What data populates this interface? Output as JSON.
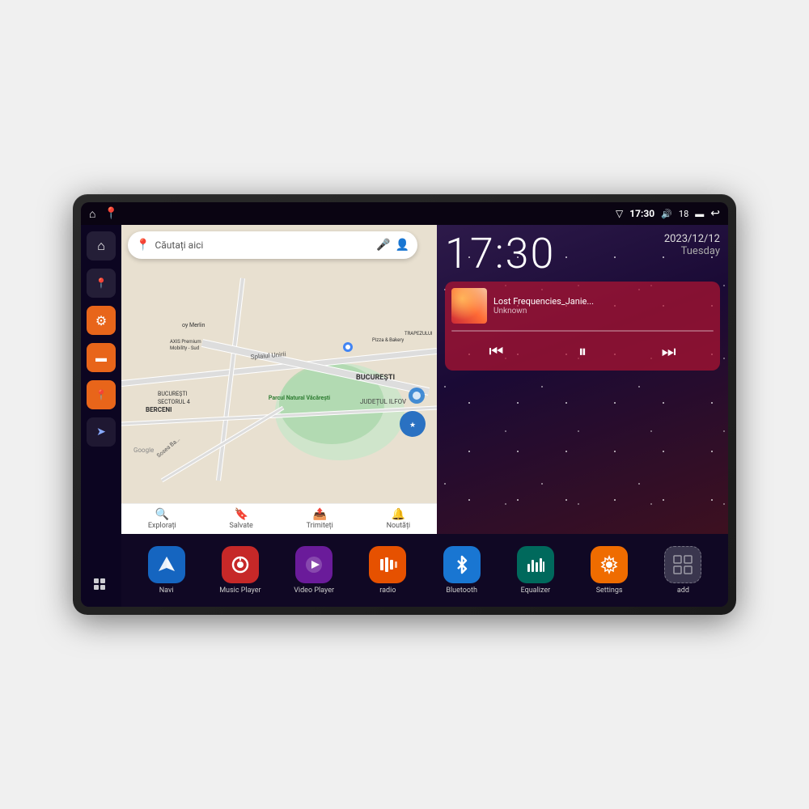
{
  "device": {
    "status_bar": {
      "signal_icon": "▼",
      "wifi_icon": "▾",
      "time": "17:30",
      "volume_icon": "🔊",
      "battery_level": "18",
      "battery_icon": "🔋",
      "back_icon": "↩"
    },
    "sidebar": {
      "items": [
        {
          "name": "home-button",
          "icon": "⌂",
          "style": "dark"
        },
        {
          "name": "maps-button",
          "icon": "📍",
          "style": "dark"
        },
        {
          "name": "settings-button",
          "icon": "⚙",
          "style": "orange"
        },
        {
          "name": "files-button",
          "icon": "📁",
          "style": "orange"
        },
        {
          "name": "maps2-button",
          "icon": "🗺",
          "style": "orange"
        },
        {
          "name": "compass-button",
          "icon": "➤",
          "style": "dark"
        },
        {
          "name": "apps-grid-button",
          "icon": "⠿",
          "style": "dark"
        }
      ]
    },
    "map": {
      "search_placeholder": "Căutați aici",
      "locations": [
        "AXIS Premium Mobility - Sud",
        "Pizza & Bakery",
        "TRAPEZULUI",
        "Parcul Natural Văcărești",
        "BUCUREȘTI",
        "SECTORUL 4",
        "JUDEȚUL ILFOV",
        "BERCENI",
        "oy Merlin"
      ],
      "bottom_nav": [
        {
          "icon": "🔍",
          "label": "Explorați"
        },
        {
          "icon": "🔖",
          "label": "Salvate"
        },
        {
          "icon": "📤",
          "label": "Trimiteți"
        },
        {
          "icon": "🔔",
          "label": "Noutăți"
        }
      ]
    },
    "clock": {
      "time": "17:30",
      "date": "2023/12/12",
      "day": "Tuesday"
    },
    "music": {
      "title": "Lost Frequencies_Janie...",
      "artist": "Unknown",
      "controls": {
        "prev": "⏮",
        "play_pause": "⏸",
        "next": "⏭"
      }
    },
    "apps": [
      {
        "name": "navi-app",
        "label": "Navi",
        "icon": "➤",
        "style": "blue"
      },
      {
        "name": "music-player-app",
        "label": "Music Player",
        "icon": "🎵",
        "style": "red"
      },
      {
        "name": "video-player-app",
        "label": "Video Player",
        "icon": "▶",
        "style": "purple"
      },
      {
        "name": "radio-app",
        "label": "radio",
        "icon": "📻",
        "style": "orange"
      },
      {
        "name": "bluetooth-app",
        "label": "Bluetooth",
        "icon": "✦",
        "style": "blue-mid"
      },
      {
        "name": "equalizer-app",
        "label": "Equalizer",
        "icon": "≡",
        "style": "teal"
      },
      {
        "name": "settings-app",
        "label": "Settings",
        "icon": "⚙",
        "style": "orange2"
      },
      {
        "name": "add-app",
        "label": "add",
        "icon": "+",
        "style": "gray"
      }
    ]
  }
}
